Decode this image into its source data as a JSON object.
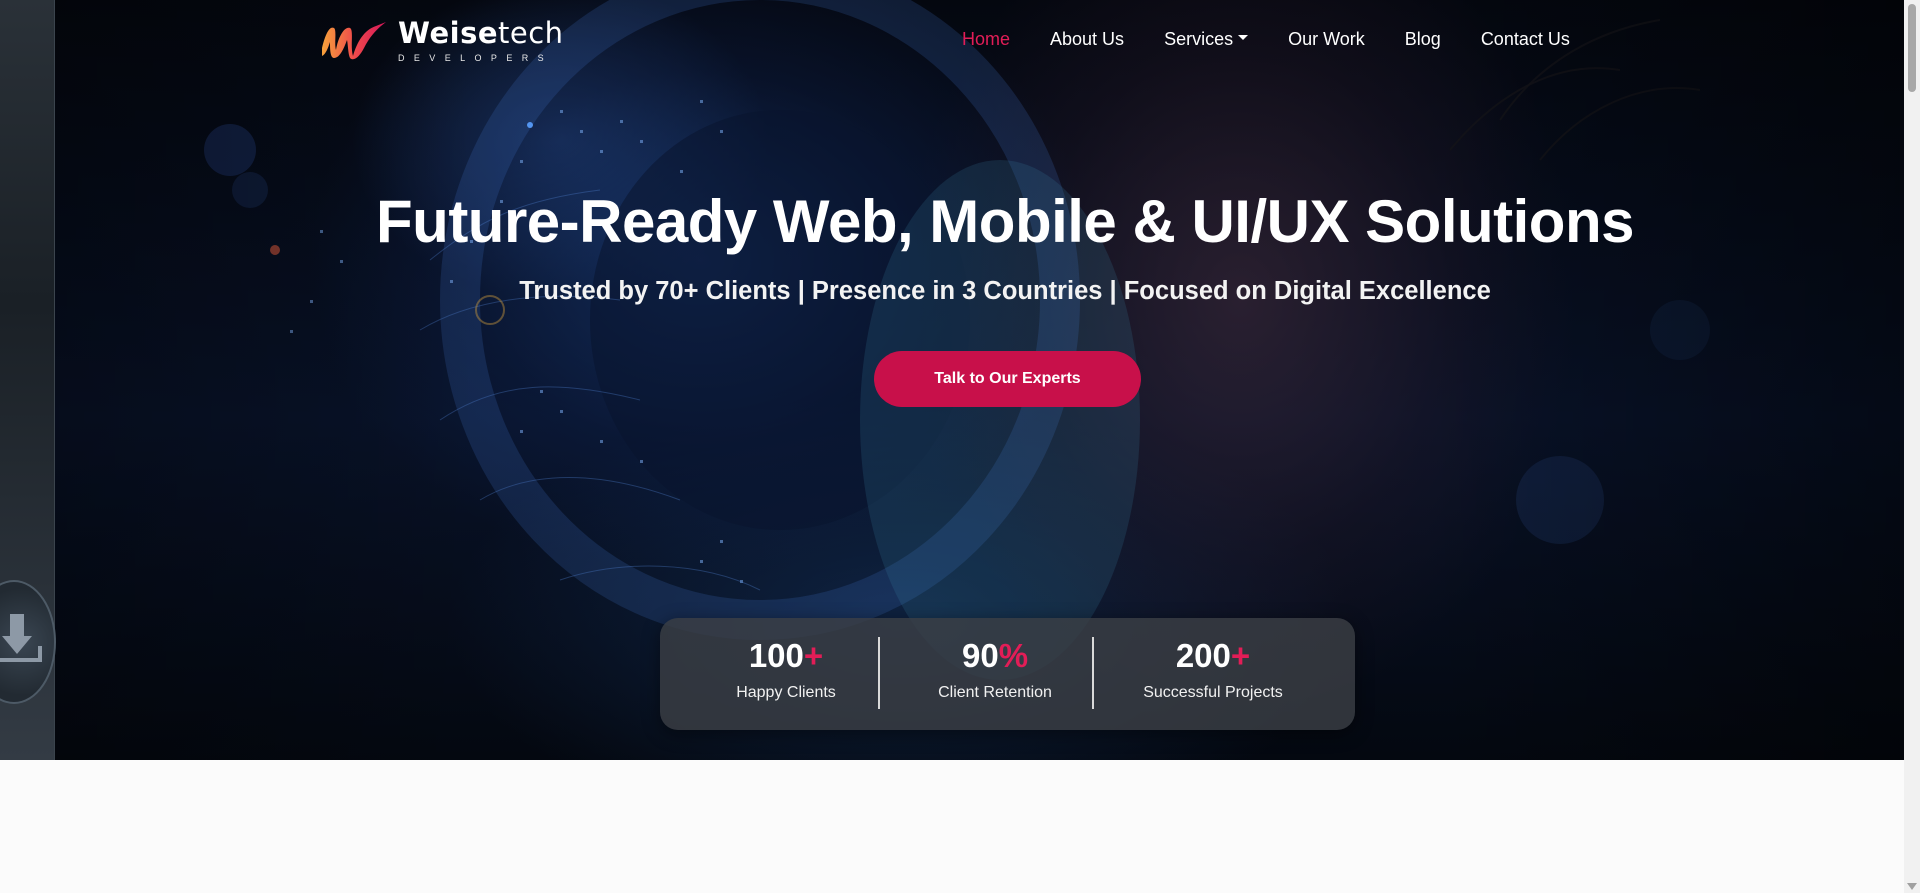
{
  "brand": {
    "name_bold": "Weise",
    "name_light": "tech",
    "tagline": "DEVELOPERS"
  },
  "nav": {
    "items": [
      {
        "label": "Home",
        "active": true
      },
      {
        "label": "About Us",
        "active": false
      },
      {
        "label": "Services",
        "active": false,
        "has_dropdown": true
      },
      {
        "label": "Our Work",
        "active": false
      },
      {
        "label": "Blog",
        "active": false
      },
      {
        "label": "Contact Us",
        "active": false
      }
    ]
  },
  "hero": {
    "headline": "Future-Ready Web, Mobile & UI/UX Solutions",
    "subline": "Trusted by 70+ Clients | Presence in 3 Countries | Focused on Digital Excellence",
    "cta_label": "Talk to Our Experts"
  },
  "stats": [
    {
      "number": "100",
      "suffix": "+",
      "label": "Happy Clients"
    },
    {
      "number": "90",
      "suffix": "%",
      "label": "Client Retention"
    },
    {
      "number": "200",
      "suffix": "+",
      "label": "Successful Projects"
    }
  ],
  "side_widget": {
    "icon": "download-icon"
  },
  "colors": {
    "accent": "#e21d57",
    "cta": "#c8104a",
    "hero_bg": "#081228",
    "page_bg": "#fbfbfb"
  }
}
